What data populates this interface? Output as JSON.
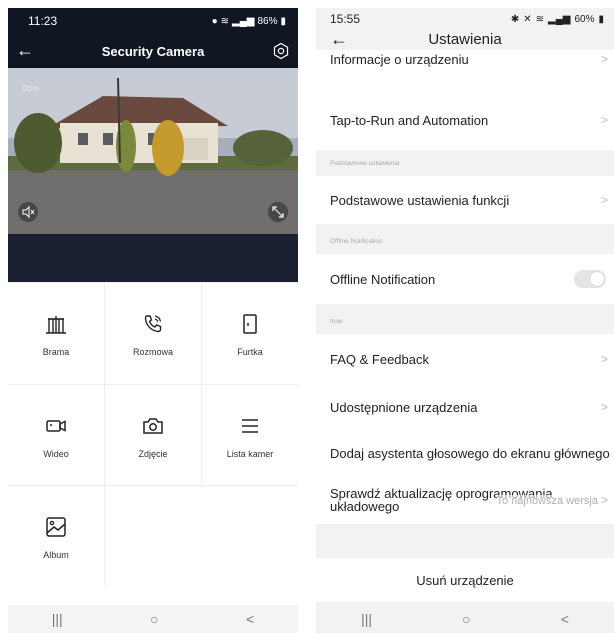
{
  "left": {
    "status": {
      "time": "11:23",
      "battery": "86%"
    },
    "header": {
      "title": "Security Camera"
    },
    "video": {
      "overlay_text": "Dom"
    },
    "tiles": [
      {
        "label": "Brama",
        "icon": "gate-icon"
      },
      {
        "label": "Rozmowa",
        "icon": "phone-call-icon"
      },
      {
        "label": "Furtka",
        "icon": "door-icon"
      },
      {
        "label": "Wideo",
        "icon": "video-camera-icon"
      },
      {
        "label": "Zdjęcie",
        "icon": "camera-icon"
      },
      {
        "label": "Lista kamer",
        "icon": "list-icon"
      },
      {
        "label": "Album",
        "icon": "image-icon"
      }
    ],
    "nav": {
      "recent": "|||",
      "home": "○",
      "back": "<"
    }
  },
  "right": {
    "status": {
      "time": "15:55",
      "battery": "60%"
    },
    "header": {
      "title": "Ustawienia"
    },
    "rows": {
      "device_info": "Informacje o urządzeniu",
      "tap_to_run": "Tap-to-Run and Automation",
      "basic_section": "Podstawowe ustawienia",
      "basic_settings": "Podstawowe ustawienia funkcji",
      "offline_section": "Offline Notification",
      "offline_notification": "Offline Notification",
      "offline_toggle": false,
      "other_section": "Inne",
      "faq": "FAQ & Feedback",
      "shared": "Udostępnione urządzenia",
      "voice": "Dodaj asystenta głosowego do ekranu głównego",
      "firmware_line1": "Sprawdź aktualizację oprogramowania",
      "firmware_line2": "układowego",
      "firmware_value": "To najnowsza wersja",
      "remove": "Usuń urządzenie"
    },
    "nav": {
      "recent": "|||",
      "home": "○",
      "back": "<"
    }
  },
  "colors": {
    "dark_header": "#111722",
    "video_bg": "#1b2130",
    "settings_bg": "#f2f2f2",
    "chevron": "#b9b9b9"
  }
}
